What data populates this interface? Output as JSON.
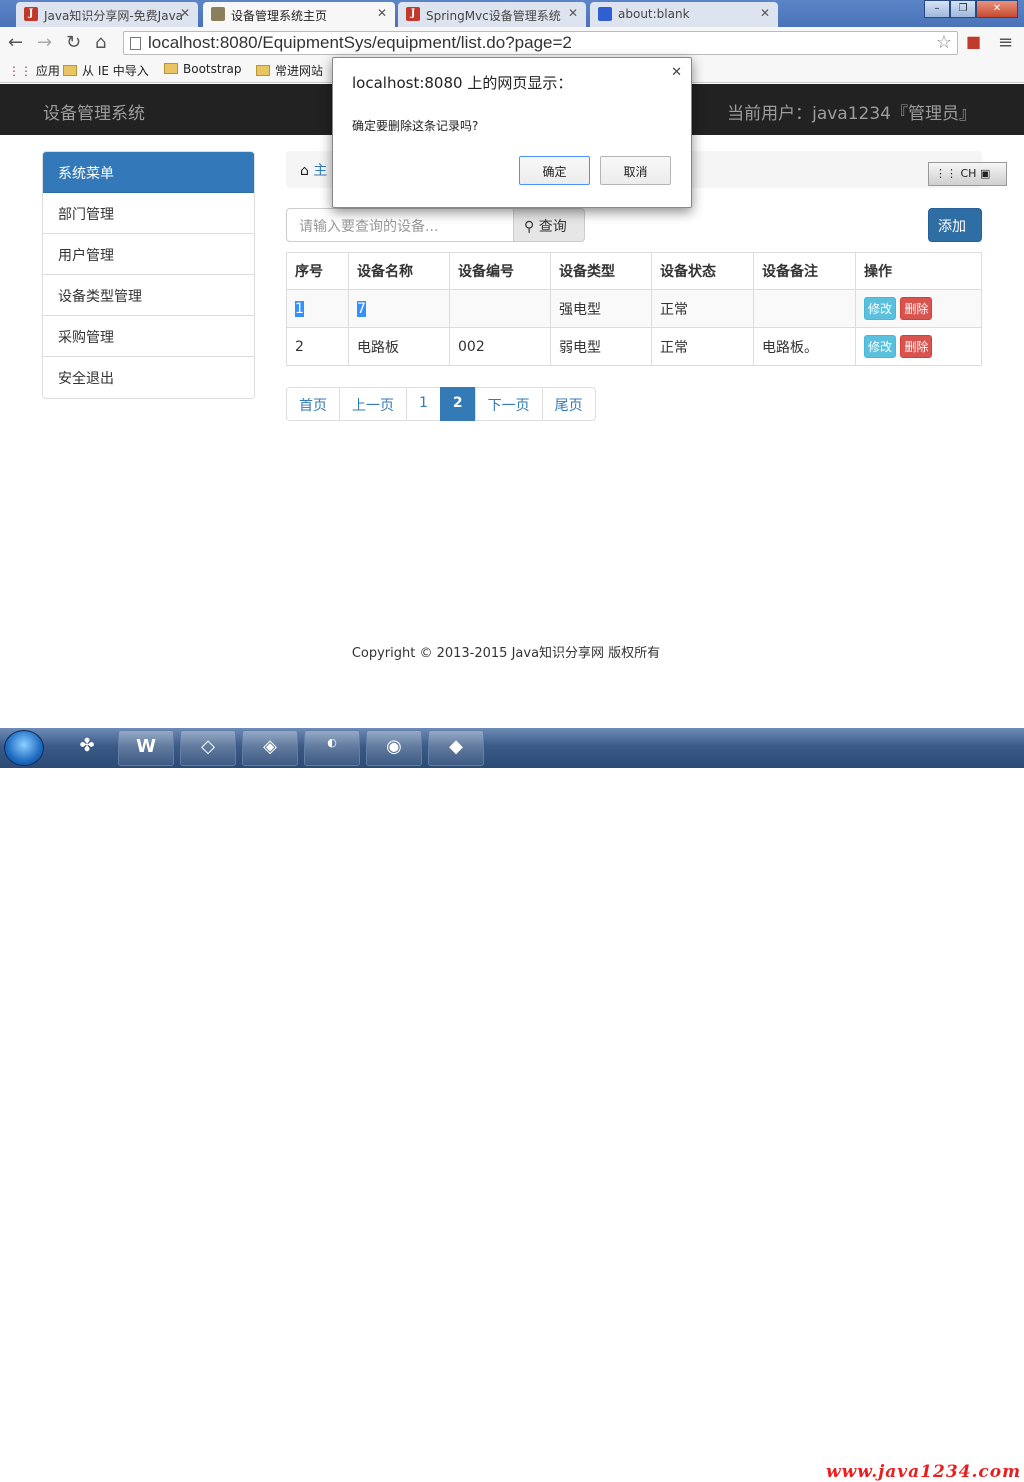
{
  "browser": {
    "tabs": [
      {
        "label": "Java知识分享网-免费Java",
        "icon": "java-logo-icon"
      },
      {
        "label": "设备管理系统主页",
        "icon": "page-icon"
      },
      {
        "label": "SpringMvc设备管理系统",
        "icon": "java-logo-icon"
      },
      {
        "label": "about:blank",
        "icon": "paw-icon"
      }
    ],
    "url": "localhost:8080/EquipmentSys/equipment/list.do?page=2",
    "bookmarks": [
      "应用",
      "从 IE 中导入",
      "Bootstrap",
      "常进网站"
    ]
  },
  "app": {
    "brand": "设备管理系统",
    "current_user": "当前用户：java1234『管理员』"
  },
  "menu": {
    "header": "系统菜单",
    "items": [
      "部门管理",
      "用户管理",
      "设备类型管理",
      "采购管理",
      "安全退出"
    ]
  },
  "breadcrumb": {
    "home_label": "主"
  },
  "search": {
    "placeholder": "请输入要查询的设备...",
    "button_label": "查询"
  },
  "add_button_label": "添加",
  "table": {
    "headers": [
      "序号",
      "设备名称",
      "设备编号",
      "设备类型",
      "设备状态",
      "设备备注",
      "操作"
    ],
    "rows": [
      {
        "index": "1",
        "name": "7",
        "code": "",
        "type": "强电型",
        "status": "正常",
        "remark": ""
      },
      {
        "index": "2",
        "name": "电路板",
        "code": "002",
        "type": "弱电型",
        "status": "正常",
        "remark": "电路板。"
      }
    ],
    "edit_label": "修改",
    "delete_label": "删除"
  },
  "pagination": [
    "首页",
    "上一页",
    "1",
    "2",
    "下一页",
    "尾页"
  ],
  "current_page": "2",
  "footer": "Copyright © 2013-2015 Java知识分享网 版权所有",
  "ime": "CH",
  "dialog": {
    "title": "localhost:8080 上的网页显示：",
    "message": "确定要删除这条记录吗?",
    "ok": "确定",
    "cancel": "取消"
  },
  "taskbar_watermark": "www.java1234.com"
}
